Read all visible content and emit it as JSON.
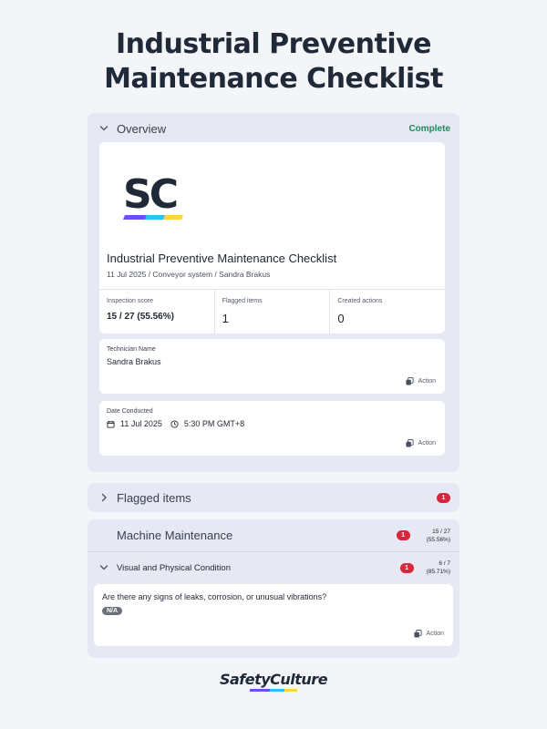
{
  "page": {
    "title_line1": "Industrial Preventive",
    "title_line2": "Maintenance Checklist"
  },
  "overview": {
    "label": "Overview",
    "status": "Complete",
    "logo": {
      "text": "SC",
      "stripe_colors": [
        "#6a4ff5",
        "#29c2f2",
        "#ffd23f"
      ]
    },
    "report_title": "Industrial Preventive Maintenance Checklist",
    "report_subtitle": "11 Jul 2025 / Conveyor system / Sandra Brakus",
    "stats": [
      {
        "label": "Inspection score",
        "value": "15 / 27 (55.56%)"
      },
      {
        "label": "Flagged items",
        "value": "1"
      },
      {
        "label": "Created actions",
        "value": "0"
      }
    ],
    "technician": {
      "label": "Technician Name",
      "value": "Sandra Brakus",
      "action": "Action"
    },
    "date": {
      "label": "Date Conducted",
      "date": "11 Jul 2025",
      "time": "5:30 PM GMT+8",
      "action": "Action"
    }
  },
  "flagged": {
    "label": "Flagged items",
    "count": "1"
  },
  "machine": {
    "label": "Machine Maintenance",
    "count": "1",
    "score_line1": "15 / 27",
    "score_line2": "(55.56%)",
    "sub": {
      "label": "Visual and Physical Condition",
      "count": "1",
      "score_line1": "6 / 7",
      "score_line2": "(85.71%)",
      "question": "Are there any signs of leaks, corrosion, or unusual vibrations?",
      "answer": "N/A",
      "action": "Action"
    }
  },
  "footer": {
    "brand": "SafetyCulture"
  },
  "colors": {
    "accent_green": "#1e8a5a",
    "flag_red": "#d8263a",
    "section_bg": "#e6e8f4"
  }
}
